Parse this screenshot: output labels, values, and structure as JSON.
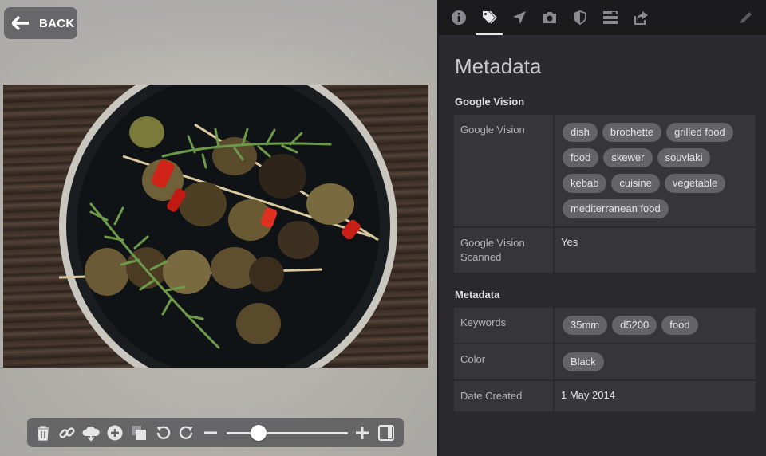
{
  "viewer": {
    "back_label": "BACK",
    "zoom_level": 0.23
  },
  "panel": {
    "tabs": [
      {
        "icon": "info-icon"
      },
      {
        "icon": "tag-icon",
        "active": true
      },
      {
        "icon": "location-icon"
      },
      {
        "icon": "camera-icon"
      },
      {
        "icon": "shield-icon"
      },
      {
        "icon": "list-icon"
      },
      {
        "icon": "share-icon"
      },
      {
        "icon": "pencil-icon"
      }
    ],
    "title": "Metadata",
    "google_vision_section": {
      "heading": "Google Vision",
      "rows": [
        {
          "key": "Google Vision",
          "tags": [
            "dish",
            "brochette",
            "grilled food",
            "food",
            "skewer",
            "souvlaki",
            "kebab",
            "cuisine",
            "vegetable",
            "mediterranean food"
          ]
        },
        {
          "key": "Google Vision Scanned",
          "value": "Yes"
        }
      ]
    },
    "metadata_section": {
      "heading": "Metadata",
      "keywords_label": "Keywords",
      "keywords": [
        "35mm",
        "d5200",
        "food"
      ],
      "color_label": "Color",
      "color_value": "Black",
      "date_label": "Date Created",
      "date_value": "1 May 2014"
    }
  },
  "colors": {
    "panel_bg": "#2b2b2f",
    "tabbar_bg": "#1b1b1e",
    "chip_bg": "#646468",
    "row_bg": "#35353a"
  }
}
